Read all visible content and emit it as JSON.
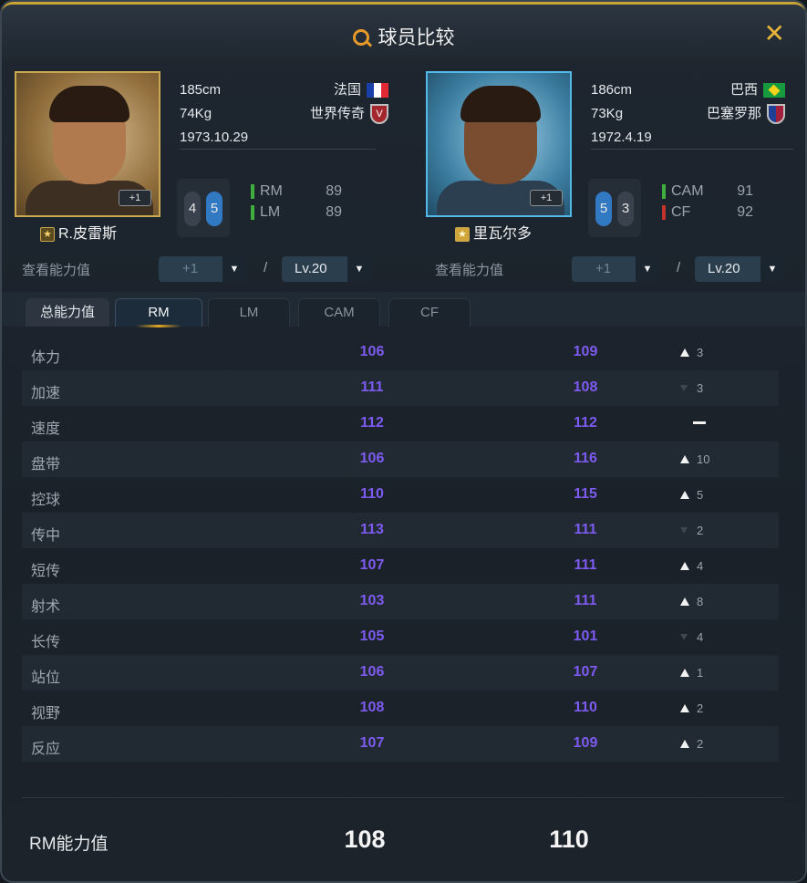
{
  "window": {
    "title": "球员比较",
    "close_label": "✕"
  },
  "players": [
    {
      "name": "R.皮雷斯",
      "height": "185cm",
      "weight": "74Kg",
      "birth": "1973.10.29",
      "nation": "法国",
      "club": "世界传奇",
      "level_badge": "+1",
      "feet": {
        "left": "4",
        "right": "5",
        "strong": "right"
      },
      "positions": [
        {
          "name": "RM",
          "value": "89",
          "color": "#3fae3f"
        },
        {
          "name": "LM",
          "value": "89",
          "color": "#3fae3f"
        }
      ],
      "view_label": "查看能力值",
      "upgrade_select": "+1",
      "level_select": "Lv.20"
    },
    {
      "name": "里瓦尔多",
      "height": "186cm",
      "weight": "73Kg",
      "birth": "1972.4.19",
      "nation": "巴西",
      "club": "巴塞罗那",
      "level_badge": "+1",
      "feet": {
        "left": "5",
        "right": "3",
        "strong": "left"
      },
      "positions": [
        {
          "name": "CAM",
          "value": "91",
          "color": "#3fae3f"
        },
        {
          "name": "CF",
          "value": "92",
          "color": "#c2332e"
        }
      ],
      "view_label": "查看能力值",
      "upgrade_select": "+1",
      "level_select": "Lv.20"
    }
  ],
  "separator": "/",
  "tabs": [
    "总能力值",
    "RM",
    "LM",
    "CAM",
    "CF"
  ],
  "active_tab": "RM",
  "stats": [
    {
      "name": "体力",
      "a": "106",
      "b": "109",
      "dir": "up",
      "diff": "3"
    },
    {
      "name": "加速",
      "a": "111",
      "b": "108",
      "dir": "down",
      "diff": "3"
    },
    {
      "name": "速度",
      "a": "112",
      "b": "112",
      "dir": "equal",
      "diff": ""
    },
    {
      "name": "盘带",
      "a": "106",
      "b": "116",
      "dir": "up",
      "diff": "10"
    },
    {
      "name": "控球",
      "a": "110",
      "b": "115",
      "dir": "up",
      "diff": "5"
    },
    {
      "name": "传中",
      "a": "113",
      "b": "111",
      "dir": "down",
      "diff": "2"
    },
    {
      "name": "短传",
      "a": "107",
      "b": "111",
      "dir": "up",
      "diff": "4"
    },
    {
      "name": "射术",
      "a": "103",
      "b": "111",
      "dir": "up",
      "diff": "8"
    },
    {
      "name": "长传",
      "a": "105",
      "b": "101",
      "dir": "down",
      "diff": "4"
    },
    {
      "name": "站位",
      "a": "106",
      "b": "107",
      "dir": "up",
      "diff": "1"
    },
    {
      "name": "视野",
      "a": "108",
      "b": "110",
      "dir": "up",
      "diff": "2"
    },
    {
      "name": "反应",
      "a": "107",
      "b": "109",
      "dir": "up",
      "diff": "2"
    }
  ],
  "total": {
    "label": "RM能力值",
    "a": "108",
    "b": "110"
  },
  "colors": {
    "accent": "#e8b43a",
    "stat_value": "#7e5bf0"
  }
}
